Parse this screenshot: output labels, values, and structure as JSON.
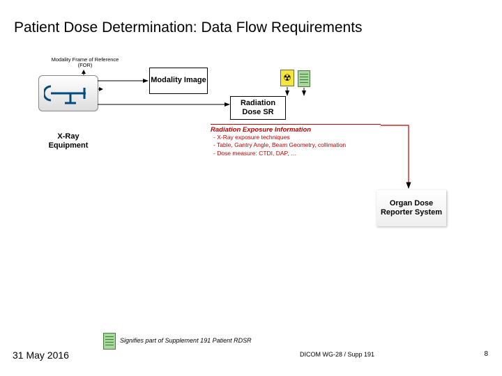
{
  "title": "Patient Dose Determination: Data Flow Requirements",
  "for_label": "Modality Frame of Reference (FOR)",
  "xray_label": "X-Ray Equipment",
  "mod_image": "Modality Image",
  "rad_dose_sr": "Radiation Dose SR",
  "rad_symbol": "☢",
  "rei": {
    "header": "Radiation Exposure Information",
    "items": [
      "- X-Ray exposure techniques",
      "- Table, Gantry Angle, Beam Geometry, collimation",
      "- Dose measure: CTDI, DAP, …"
    ]
  },
  "organ_dose": "Organ Dose Reporter System",
  "footer": {
    "date": "31 May 2016",
    "legend": "Signifies part of Supplement 191 Patient RDSR",
    "center": "DICOM WG-28 / Supp 191",
    "page": "8"
  }
}
